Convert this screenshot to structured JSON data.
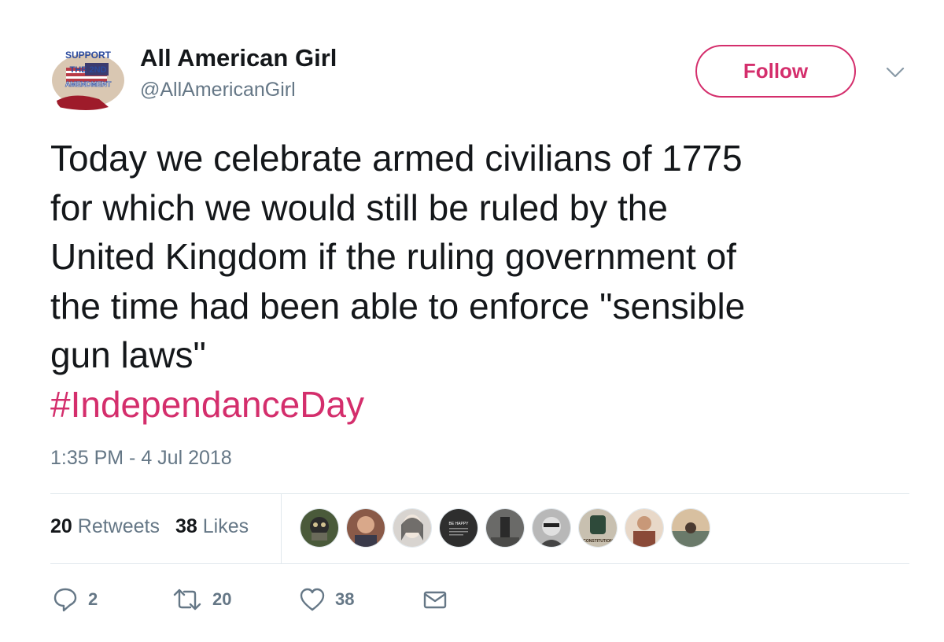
{
  "user": {
    "display_name": "All American Girl",
    "handle": "@AllAmericanGirl",
    "avatar_text": [
      "SUPPORT",
      "THE 2ND",
      "AMENDMENT"
    ]
  },
  "follow_label": "Follow",
  "tweet": {
    "lines": [
      "Today we celebrate armed civilians of 1775",
      "for which we would still be ruled by the",
      "United Kingdom if the ruling government of",
      "the time had been able to enforce \"sensible",
      "gun laws\""
    ],
    "hashtag": "#IndependanceDay",
    "timestamp": "1:35 PM - 4 Jul 2018"
  },
  "stats": {
    "retweets_count": "20",
    "retweets_label": "Retweets",
    "likes_count": "38",
    "likes_label": "Likes"
  },
  "likers": [
    {
      "name": "liker-1",
      "color": "#4a5a3a"
    },
    {
      "name": "liker-2",
      "color": "#8a5a48"
    },
    {
      "name": "liker-3",
      "color": "#d8d4d0"
    },
    {
      "name": "liker-4",
      "color": "#2e2e2e",
      "text": "BE HAPPY"
    },
    {
      "name": "liker-5",
      "color": "#6a6a68"
    },
    {
      "name": "liker-6",
      "color": "#b8b8b8"
    },
    {
      "name": "liker-7",
      "color": "#5a6a5a",
      "text": "CONSTITUTION"
    },
    {
      "name": "liker-8",
      "color": "#a06848"
    },
    {
      "name": "liker-9",
      "color": "#7a7870"
    }
  ],
  "actions": {
    "reply_count": "2",
    "retweet_count": "20",
    "like_count": "38"
  },
  "colors": {
    "accent": "#d42e6c",
    "secondary_text": "#657786",
    "primary_text": "#14171a",
    "divider": "#e1e8ed"
  },
  "icons": [
    "chevron-down-icon",
    "reply-icon",
    "retweet-icon",
    "heart-icon",
    "envelope-icon"
  ]
}
